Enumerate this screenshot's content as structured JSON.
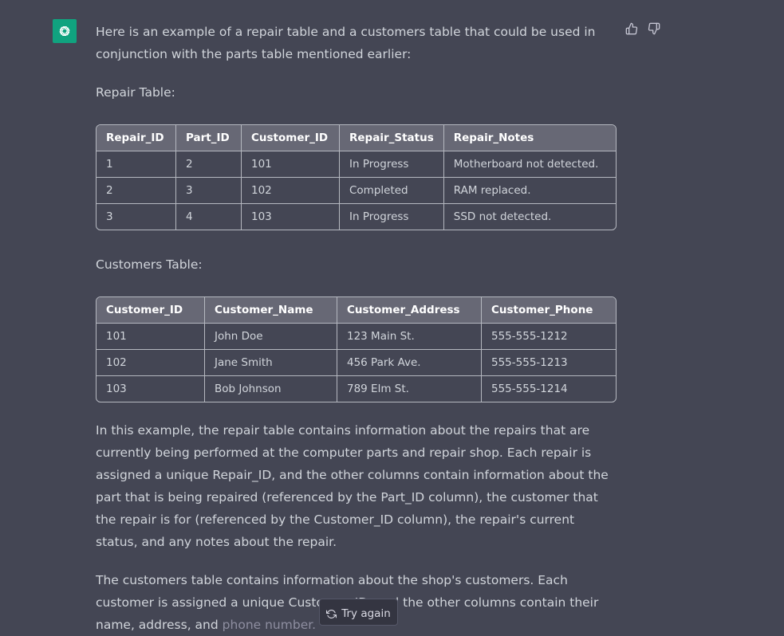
{
  "message": {
    "intro": "Here is an example of a repair table and a customers table that could be used in conjunction with the parts table mentioned earlier:",
    "repair_label": "Repair Table:",
    "customers_label": "Customers Table:",
    "paragraph1": "In this example, the repair table contains information about the repairs that are currently being performed at the computer parts and repair shop. Each repair is assigned a unique Repair_ID, and the other columns contain information about the part that is being repaired (referenced by the Part_ID column), the customer that the repair is for (referenced by the Customer_ID column), the repair's current status, and any notes about the repair.",
    "paragraph2_main": "The customers table contains information about the shop's customers. Each customer is assigned a unique Customer_ID, and the other columns contain their name, address, and",
    "paragraph2_faded": "phone number."
  },
  "repair_table": {
    "headers": [
      "Repair_ID",
      "Part_ID",
      "Customer_ID",
      "Repair_Status",
      "Repair_Notes"
    ],
    "rows": [
      [
        "1",
        "2",
        "101",
        "In Progress",
        "Motherboard not detected."
      ],
      [
        "2",
        "3",
        "102",
        "Completed",
        "RAM replaced."
      ],
      [
        "3",
        "4",
        "103",
        "In Progress",
        "SSD not detected."
      ]
    ]
  },
  "customers_table": {
    "headers": [
      "Customer_ID",
      "Customer_Name",
      "Customer_Address",
      "Customer_Phone"
    ],
    "rows": [
      [
        "101",
        "John Doe",
        "123 Main St.",
        "555-555-1212"
      ],
      [
        "102",
        "Jane Smith",
        "456 Park Ave.",
        "555-555-1213"
      ],
      [
        "103",
        "Bob Johnson",
        "789 Elm St.",
        "555-555-1214"
      ]
    ]
  },
  "actions": {
    "try_again_label": "Try again",
    "thumbs_up_icon": "thumbs-up-icon",
    "thumbs_down_icon": "thumbs-down-icon",
    "regenerate_icon": "refresh-icon"
  },
  "colors": {
    "background": "#444654",
    "avatar": "#10a37f",
    "header_bg": "#676875"
  }
}
